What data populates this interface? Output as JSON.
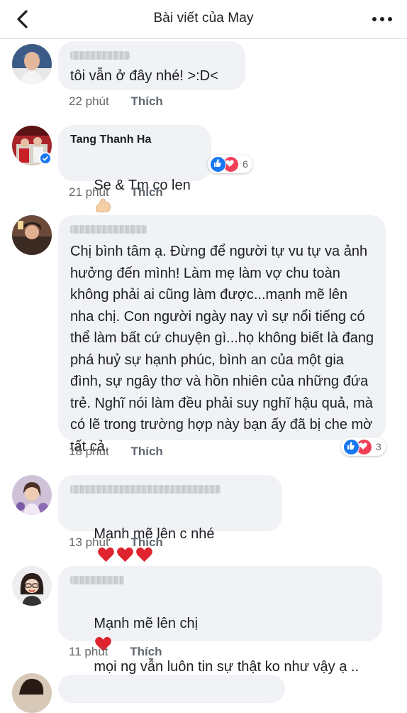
{
  "header": {
    "title": "Bài viết của May"
  },
  "comments": [
    {
      "author": "",
      "text": "tôi vẫn ở đây nhé! >:D<",
      "time": "22 phút",
      "like_label": "Thích"
    },
    {
      "author": "Tang Thanh Ha",
      "text": "Se & Tm co len",
      "time": "21 phút",
      "like_label": "Thích",
      "reaction_count": "6"
    },
    {
      "author": "",
      "text": "Chị bình tâm ạ. Đừng để người tự vu tự va ảnh hưởng đến mình! Làm mẹ làm vợ chu toàn không phải ai cũng làm được...mạnh mẽ lên nha chị. Con người ngày nay vì sự nổi tiếng có thể làm bất cứ chuyện gì...họ không biết là đang phá huỷ sự hạnh phúc, bình an của một gia đình, sự ngây thơ và hồn nhiên của những đứa trẻ. Nghĩ nói làm đều phải suy nghĩ hậu quả, mà có lẽ trong trường hợp này bạn ấy đã bị che mờ tất cả.",
      "time": "18 phút",
      "like_label": "Thích",
      "reaction_count": "3"
    },
    {
      "author": "",
      "text": "Mạnh mẽ lên c nhé",
      "time": "13 phút",
      "like_label": "Thích"
    },
    {
      "author": "",
      "text_before": "Mạnh mẽ lên chị",
      "text_after": "mọi ng vẫn luôn tin sự thật ko như vậy ạ ..",
      "time": "11 phút",
      "like_label": "Thích"
    }
  ],
  "colors": {
    "like_blue": "#1877f2",
    "love_red": "#f33e58",
    "bubble_bg": "#f0f2f5",
    "meta_gray": "#65676b"
  }
}
